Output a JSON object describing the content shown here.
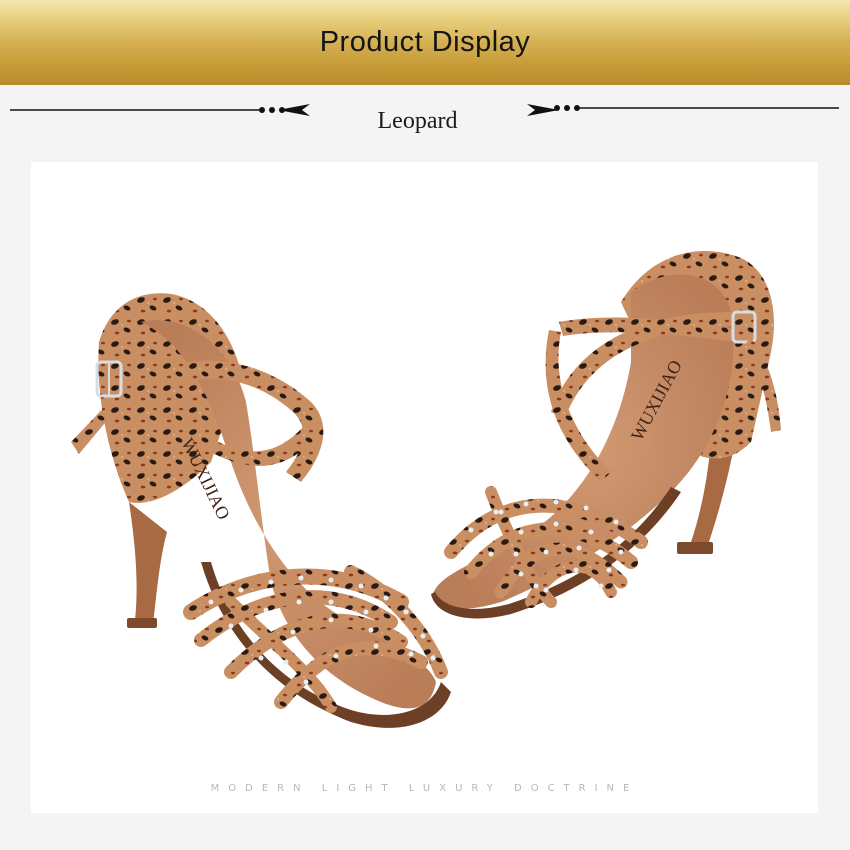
{
  "banner": {
    "title": "Product Display",
    "gradient_colors": [
      "#f4e6b0",
      "#d4b053",
      "#b88a2c"
    ]
  },
  "subtitle": "Leopard",
  "product_image": {
    "description_icon": "shoe-photo",
    "brand_imprint_left": "WUXIJIAO",
    "brand_imprint_right": "WUXIJIAO",
    "colors": {
      "satin_base": "#c98e62",
      "leopard_spot": "#2a1a14",
      "leopard_accent": "#8a3a1f",
      "insole": "#c88d67",
      "heel": "#a86a43",
      "rhinestone": "#e8eef2"
    }
  },
  "tagline": "MODERN LIGHT LUXURY DOCTRINE"
}
